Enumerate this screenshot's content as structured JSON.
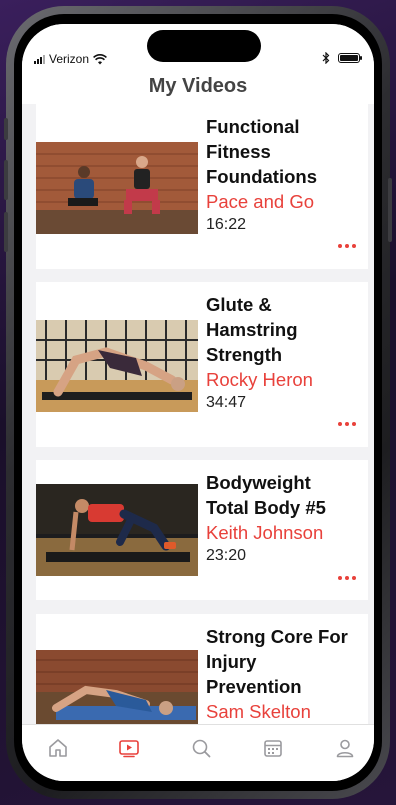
{
  "status_bar": {
    "carrier": "Verizon"
  },
  "header": {
    "title": "My Videos"
  },
  "videos": [
    {
      "title_lines": [
        "Functional",
        "Fitness",
        "Foundations"
      ],
      "instructor": "Pace and Go",
      "duration": "16:22",
      "thumbnail": "two-trainers-squat-brick-studio"
    },
    {
      "title_lines": [
        "Glute &",
        "Hamstring",
        "Strength"
      ],
      "instructor": "Rocky Heron",
      "duration": "34:47",
      "thumbnail": "trainer-glute-bridge-mat"
    },
    {
      "title_lines": [
        "Bodyweight",
        "Total Body #5"
      ],
      "instructor": "Keith Johnson",
      "duration": "23:20",
      "thumbnail": "trainer-knee-drive-plank"
    },
    {
      "title_lines": [
        "Strong Core For",
        "Injury",
        "Prevention"
      ],
      "instructor": "Sam Skelton",
      "duration": "",
      "thumbnail": "trainer-bridge-blue-mat"
    }
  ],
  "tab_bar": {
    "tabs": [
      {
        "icon": "home-icon",
        "active": false
      },
      {
        "icon": "play-video-icon",
        "active": true
      },
      {
        "icon": "search-icon",
        "active": false
      },
      {
        "icon": "calendar-icon",
        "active": false
      },
      {
        "icon": "profile-icon",
        "active": false
      }
    ],
    "active_color": "#e8413b",
    "inactive_color": "#9a9a9e"
  },
  "colors": {
    "accent": "#e8413b",
    "title_text": "#111111",
    "header_text": "#444444"
  }
}
